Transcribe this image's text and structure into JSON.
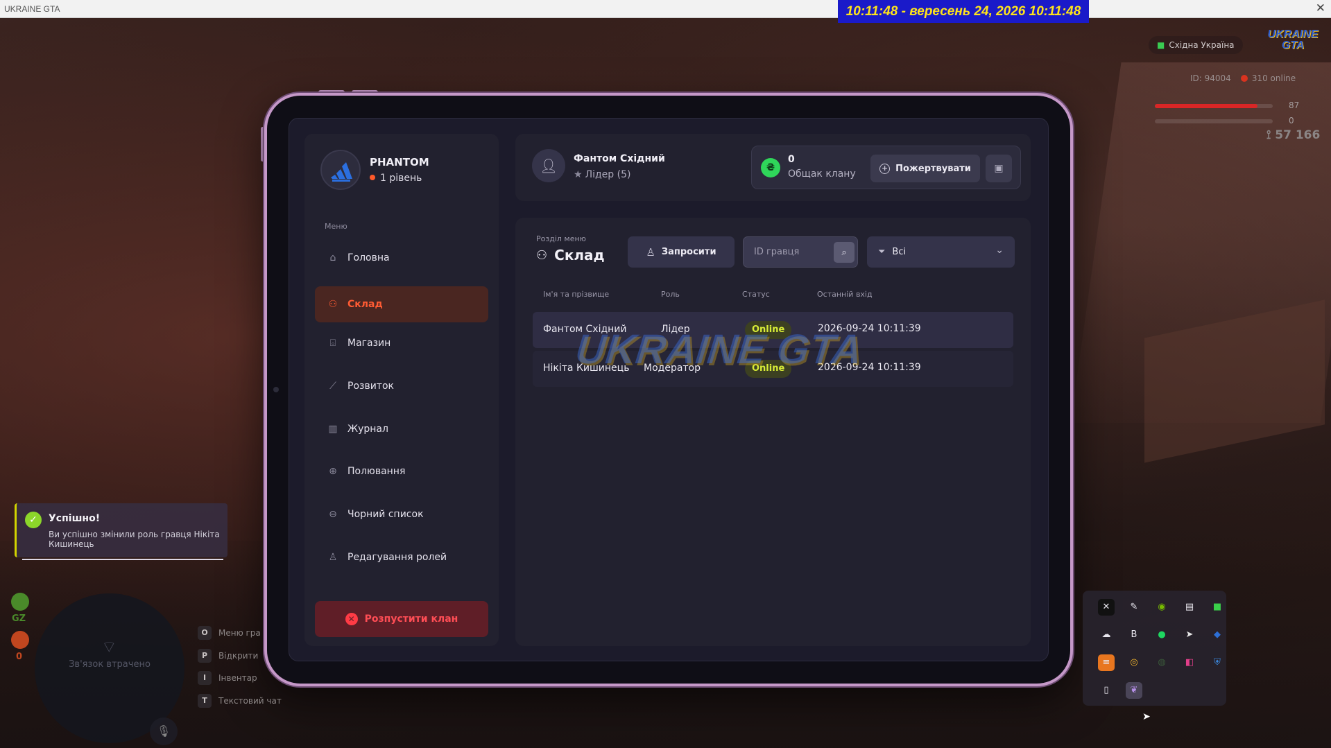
{
  "window": {
    "title": "UKRAINE GTA",
    "close_glyph": "✕"
  },
  "clock": "10:11:48  - вересень 24, 2026 10:11:48",
  "hud": {
    "region": "Східна Україна",
    "logo": "UKRAINE GTA",
    "player_id": "ID: 94004",
    "online": "310 online",
    "health": "87",
    "armor": "0",
    "money": "57 166",
    "health_fraction": 0.87,
    "colors": {
      "health": "#d92626",
      "accent": "#ff5b33"
    }
  },
  "clan": {
    "name": "PHANTOM",
    "level": "1 рівень"
  },
  "menu": {
    "caption": "Меню",
    "items": [
      {
        "label": "Головна",
        "icon": "home-icon",
        "active": false
      },
      {
        "label": "Склад",
        "icon": "people-icon",
        "active": true
      },
      {
        "label": "Магазин",
        "icon": "shop-icon",
        "active": false
      },
      {
        "label": "Розвиток",
        "icon": "chart-icon",
        "active": false
      },
      {
        "label": "Журнал",
        "icon": "book-icon",
        "active": false
      },
      {
        "label": "Полювання",
        "icon": "crosshair-icon",
        "active": false
      },
      {
        "label": "Чорний список",
        "icon": "blacklist-icon",
        "active": false
      },
      {
        "label": "Редагування ролей",
        "icon": "user-edit-icon",
        "active": false
      }
    ],
    "disband_label": "Розпустити клан"
  },
  "leader": {
    "name": "Фантом Східний",
    "role": "Лідер (5)"
  },
  "treasury": {
    "amount": "0",
    "label": "Общак клану",
    "donate_label": "Пожертвувати"
  },
  "section": {
    "caption": "Розділ меню",
    "title": "Склад",
    "invite_label": "Запросити",
    "search_placeholder": "ID гравця",
    "filter_value": "Всі"
  },
  "table": {
    "headers": [
      "Ім'я та прізвище",
      "Роль",
      "Статус",
      "Останній вхід"
    ],
    "rows": [
      {
        "name": "Фантом Східний",
        "role": "Лідер",
        "status": "Online",
        "last_login": "2026-09-24 10:11:39"
      },
      {
        "name": "Нікіта Кишинець",
        "role": "Модератор",
        "status": "Online",
        "last_login": "2026-09-24 10:11:39"
      }
    ]
  },
  "watermark": "UKRAINE GTA",
  "notification": {
    "title": "Успішно!",
    "text": "Ви успішно змінили роль гравця Нікіта Кишинець"
  },
  "minimap": {
    "status": "Зв'язок втрачено"
  },
  "left_hud": {
    "gz_label": "GZ",
    "zero": "0"
  },
  "keybinds": [
    {
      "key": "O",
      "label": "Меню гра"
    },
    {
      "key": "P",
      "label": "Відкрити"
    },
    {
      "key": "I",
      "label": "Інвентар"
    },
    {
      "key": "T",
      "label": "Текстовий чат"
    }
  ]
}
